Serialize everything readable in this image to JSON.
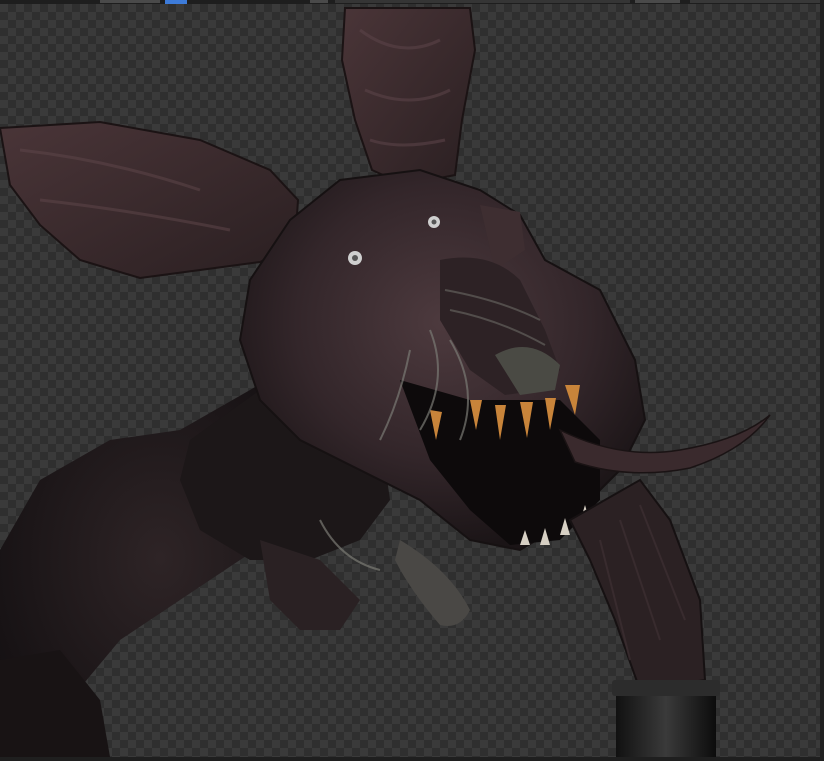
{
  "viewport": {
    "background": "checkerboard-transparency",
    "subject": "3d-creature-model",
    "colors": {
      "checker_dark": "#2f2f2f",
      "checker_light": "#3a3a3a",
      "active_tab": "#3d7bd9",
      "creature_skin": "#3b2a2e",
      "creature_shadow": "#1a1416",
      "teeth": "#c8843a"
    }
  }
}
